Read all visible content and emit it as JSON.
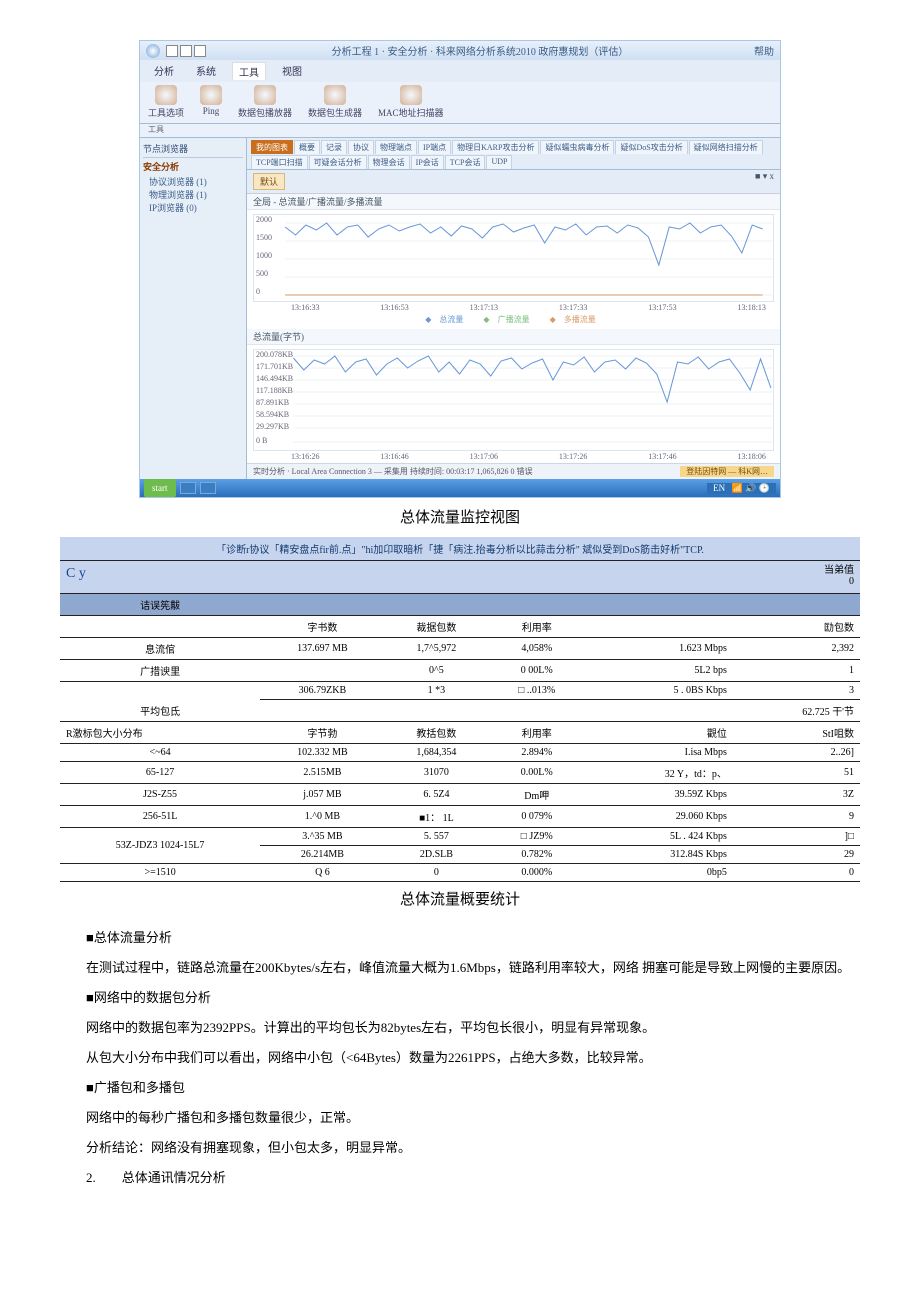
{
  "screenshot": {
    "window_title": "分析工程 1 · 安全分析 · 科来网络分析系统2010 政府惠规划（评估）",
    "help": "帮助",
    "menu": [
      "分析",
      "系统",
      "工具",
      "视图"
    ],
    "toolbar_items": [
      "工具选项",
      "Ping",
      "数据包播放器",
      "数据包生成器",
      "MAC地址扫描器"
    ],
    "ribbon_group": "工具",
    "sidebar": {
      "title": "节点浏览器",
      "group": "安全分析",
      "items": [
        "协议浏览器 (1)",
        "物理浏览器 (1)",
        "IP浏览器 (0)"
      ]
    },
    "tabs": [
      "我的图表",
      "概要",
      "记录",
      "协议",
      "物理端点",
      "IP端点",
      "物理日KARP攻击分析",
      "疑似蠕虫病毒分析",
      "疑似DoS攻击分析",
      "疑似网络扫描分析",
      "TCP端口扫描",
      "可疑会话分析",
      "物理会话",
      "IP会话",
      "TCP会话",
      "UDP"
    ],
    "def_btn": "默认",
    "subtitle_top": "全局 - 总流量/广播流量/多播流量",
    "chart1": {
      "yticks": [
        "2000",
        "1500",
        "1000",
        "500",
        "0"
      ],
      "xticks": [
        "13:16:33",
        "13:16:53",
        "13:17:13",
        "13:17:33",
        "13:17:53",
        "13:18:13"
      ],
      "legend": [
        "总流量",
        "广播流量",
        "多播流量"
      ]
    },
    "subtitle_mid": "总流量(字节)",
    "chart2": {
      "yticks": [
        "200.078KB",
        "171.701KB",
        "146.494KB",
        "117.188KB",
        "87.891KB",
        "58.594KB",
        "29.297KB",
        "0 B"
      ],
      "xticks": [
        "13:16:26",
        "13:16:46",
        "13:17:06",
        "13:17:26",
        "13:17:46",
        "13:18:06"
      ]
    },
    "footer_left": "实时分析 · Local Area Connection 3 — 采集用  持续时间: 00:03:17  1,065,826  0 错误",
    "taskbar": {
      "start": "start",
      "right": "登陆因特网  — 科K网…"
    }
  },
  "caption_chart": "总体流量监控视图",
  "table": {
    "top_band": "「诊断r协议「精安盘点fir前.点」\"hi加卬取暗析「捷「病注.抬毒分析以比蒜击分析\" 斌似受到DoS筋击好析\"TCP.",
    "cy": "C y",
    "dangqian_label": "当弟值",
    "dangqian_value": "0",
    "err_label": "诘误筅黻",
    "headers1": [
      "字书数",
      "裁据包数",
      "利用率",
      "",
      "劻包数"
    ],
    "headers2": [
      "字节勃",
      "教括包数",
      "利用率",
      "觀位",
      "StI咀数"
    ],
    "rows_top": [
      {
        "name": "息流倌",
        "c": [
          "137.697 MB",
          "1,7^5,972",
          "4,058%",
          "1.623 Mbps",
          "2,392"
        ]
      },
      {
        "name": "广措谀里",
        "c": [
          "",
          "0^5",
          "0 00L%",
          "5L2 bps",
          "1"
        ]
      },
      {
        "name": "",
        "c": [
          "306.79ZKB",
          "1  *3",
          "□ ..013%",
          "5 . 0BS Kbps",
          "3"
        ]
      },
      {
        "name": "平均包氐",
        "c": [
          "",
          "",
          "",
          "",
          "62.725 干'节"
        ]
      }
    ],
    "mid_label": "R激标包大小分布",
    "rows_bot": [
      {
        "name": "<~64",
        "c": [
          "102.332 MB",
          "1,684,354",
          "2.894%",
          "I.isa Mbps",
          "2..26]"
        ]
      },
      {
        "name": "65-127",
        "c": [
          "2.515MB",
          "31070",
          "0.00L%",
          "32  Y，td：p、",
          "51"
        ]
      },
      {
        "name": "J2S-Z55",
        "c": [
          "j.057 MB",
          "6. 5Z4",
          "Dm呷",
          "39.59Z Kbps",
          "3Z"
        ]
      },
      {
        "name": "256-51L",
        "c": [
          "1.^0 MB",
          "■1：  1L",
          "0 079%",
          "29.060 Kbps",
          "9"
        ]
      },
      {
        "name": "53Z-JDZ3 1024-15L7",
        "c": [
          "3.^35 MB",
          "5. 557",
          "□  JZ9%",
          "5L . 424  Kbps",
          "]□"
        ],
        "c2": [
          "26.214MB",
          "2D.SLB",
          "0.782%",
          "312.84S Kbps",
          "29"
        ]
      },
      {
        "name": ">=1510",
        "c": [
          "Q 6",
          "0",
          "0.000%",
          "0bp5",
          "0"
        ]
      }
    ]
  },
  "caption_table": "总体流量概要统计",
  "body": {
    "h1": "■总体流量分析",
    "p1": "在测试过程中，链路总流量在200Kbytes/s左右，峰值流量大概为1.6Mbps，链路利用率较大，网络 拥塞可能是导致上网慢的主要原因。",
    "h2": "■网络中的数据包分析",
    "p2a": "网络中的数据包率为2392PPS。计算出的平均包长为82bytes左右，平均包长很小，明显有异常现象。",
    "p2b": "从包大小分布中我们可以看出，网络中小包（<64Bytes）数量为2261PPS，占绝大多数，比较异常。",
    "h3": "■广播包和多播包",
    "p3a": "网络中的每秒广播包和多播包数量很少，正常。",
    "p3b": "分析结论：网络没有拥塞现象，但小包太多，明显异常。",
    "sec2": "2.　　总体通讯情况分析"
  }
}
